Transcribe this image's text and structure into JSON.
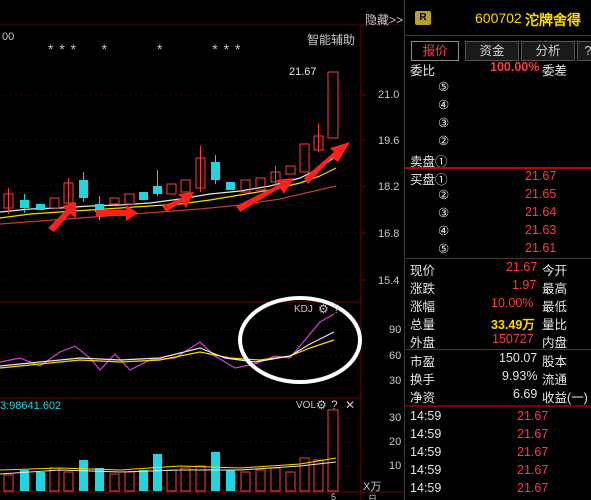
{
  "chart": {
    "left_label_1": "00",
    "left_label_2": "3:98641.602",
    "stars_line": "* * *     *          *          * * *",
    "hide_label": "隐藏>>",
    "smart_assist": "智能辅助",
    "price_high_label": "21.67",
    "price_axis": [
      "21.0",
      "19.6",
      "18.2",
      "16.8",
      "15.4"
    ],
    "kdj_title": "KDJ",
    "kdj_axis": [
      "90",
      "60",
      "30"
    ],
    "vol_title": "VOL",
    "vol_axis": [
      "30",
      "20",
      "10"
    ],
    "vol_unit": "X万",
    "bottom_partial": "5",
    "bottom_right_partial": "日"
  },
  "header": {
    "badge": "R",
    "stock_code": "600702",
    "stock_name": "沱牌舍得"
  },
  "tabs": [
    {
      "label": "报价",
      "active": true
    },
    {
      "label": "资金",
      "active": false
    },
    {
      "label": "分析",
      "active": false
    },
    {
      "label": "?",
      "active": false
    }
  ],
  "commission": {
    "label": "委比",
    "value": "100.00%",
    "label2": "委差"
  },
  "sell": [
    {
      "label": "⑤",
      "price": ""
    },
    {
      "label": "④",
      "price": ""
    },
    {
      "label": "③",
      "price": ""
    },
    {
      "label": "②",
      "price": ""
    },
    {
      "label": "卖盘①",
      "price": ""
    }
  ],
  "buy": [
    {
      "label": "买盘①",
      "price": "21.67"
    },
    {
      "label": "②",
      "price": "21.65"
    },
    {
      "label": "③",
      "price": "21.64"
    },
    {
      "label": "④",
      "price": "21.63"
    },
    {
      "label": "⑤",
      "price": "21.61"
    }
  ],
  "quote": [
    {
      "label": "现价",
      "value": "21.67",
      "label2": "今开",
      "color": "red"
    },
    {
      "label": "涨跌",
      "value": "1.97",
      "label2": "最高",
      "color": "red"
    },
    {
      "label": "涨幅",
      "value": "10.00%",
      "label2": "最低",
      "color": "red"
    },
    {
      "label": "总量",
      "value": "33.49万",
      "label2": "量比",
      "color": "yellow"
    },
    {
      "label": "外盘",
      "value": "150727",
      "label2": "内盘",
      "color": "red"
    }
  ],
  "fundamentals": [
    {
      "label": "市盈",
      "value": "150.07",
      "label2": "股本"
    },
    {
      "label": "换手",
      "value": "9.93%",
      "label2": "流通"
    },
    {
      "label": "净资",
      "value": "6.69",
      "label2": "收益(一)"
    }
  ],
  "ticks": [
    {
      "time": "14:59",
      "price": "21.67"
    },
    {
      "time": "14:59",
      "price": "21.67"
    },
    {
      "time": "14:59",
      "price": "21.67"
    },
    {
      "time": "14:59",
      "price": "21.67"
    },
    {
      "time": "14:59",
      "price": "21.67"
    }
  ],
  "colors": {
    "up": "#ff3b3b",
    "down": "#1fd5e0",
    "ma5": "#e6e6e6",
    "ma10": "#ffd800",
    "ma20": "#d63fd6",
    "annotation": "#ffffff"
  }
}
